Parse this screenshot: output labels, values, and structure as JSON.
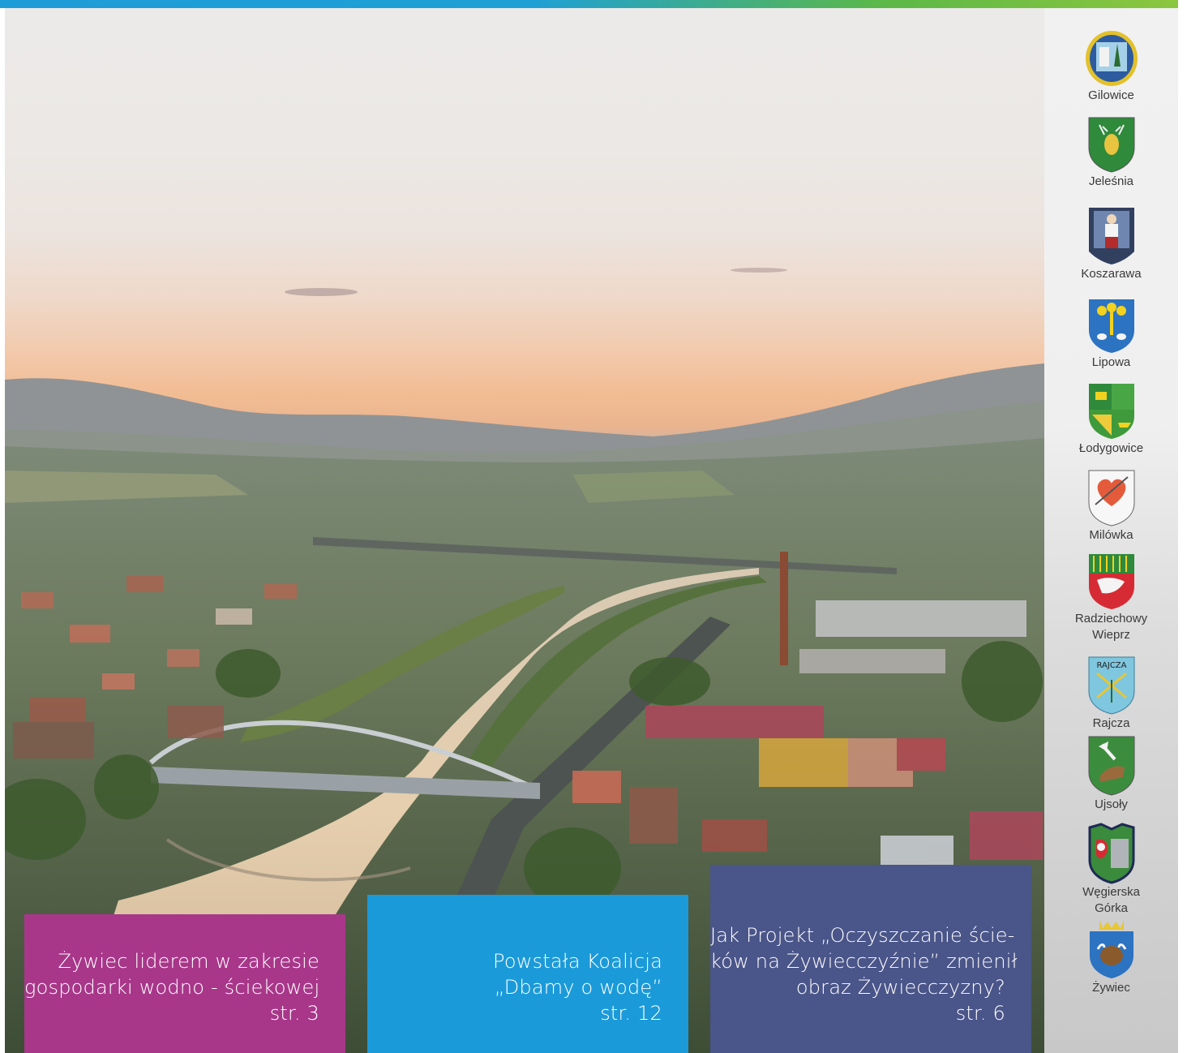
{
  "header": {
    "accent_gradient": [
      "#1e9cd7",
      "#8cc63f"
    ]
  },
  "articles": [
    {
      "lines": [
        "Żywiec liderem w zakresie",
        "gospodarki wodno - ściekowej",
        "str. 3"
      ],
      "color": "#a8378a"
    },
    {
      "lines": [
        "Powstała Koalicja",
        "„Dbamy o wodę”",
        "str. 12"
      ],
      "color": "#1b9ad9"
    },
    {
      "lines": [
        "Jak Projekt „Oczyszczanie ście-",
        "ków na Żywiecczyźnie” zmienił",
        "obraz Żywiecczyzny?",
        "str. 6"
      ],
      "color": "#4a5589"
    }
  ],
  "sidebar": {
    "crests": [
      {
        "name": "Gilowice",
        "icon": "gilowice-crest-icon"
      },
      {
        "name": "Jeleśnia",
        "icon": "jelesnia-crest-icon"
      },
      {
        "name": "Koszarawa",
        "icon": "koszarawa-crest-icon"
      },
      {
        "name": "Lipowa",
        "icon": "lipowa-crest-icon"
      },
      {
        "name": "Łodygowice",
        "icon": "lodygowice-crest-icon"
      },
      {
        "name": "Milówka",
        "icon": "milowka-crest-icon"
      },
      {
        "name": "Radziechowy\nWieprz",
        "icon": "radziechowy-wieprz-crest-icon"
      },
      {
        "name": "Rajcza",
        "icon": "rajcza-crest-icon",
        "crest_text": "RAJCZA"
      },
      {
        "name": "Ujsoły",
        "icon": "ujsoly-crest-icon"
      },
      {
        "name": "Węgierska\nGórka",
        "icon": "wegierska-gorka-crest-icon"
      },
      {
        "name": "Żywiec",
        "icon": "zywiec-crest-icon"
      }
    ]
  }
}
